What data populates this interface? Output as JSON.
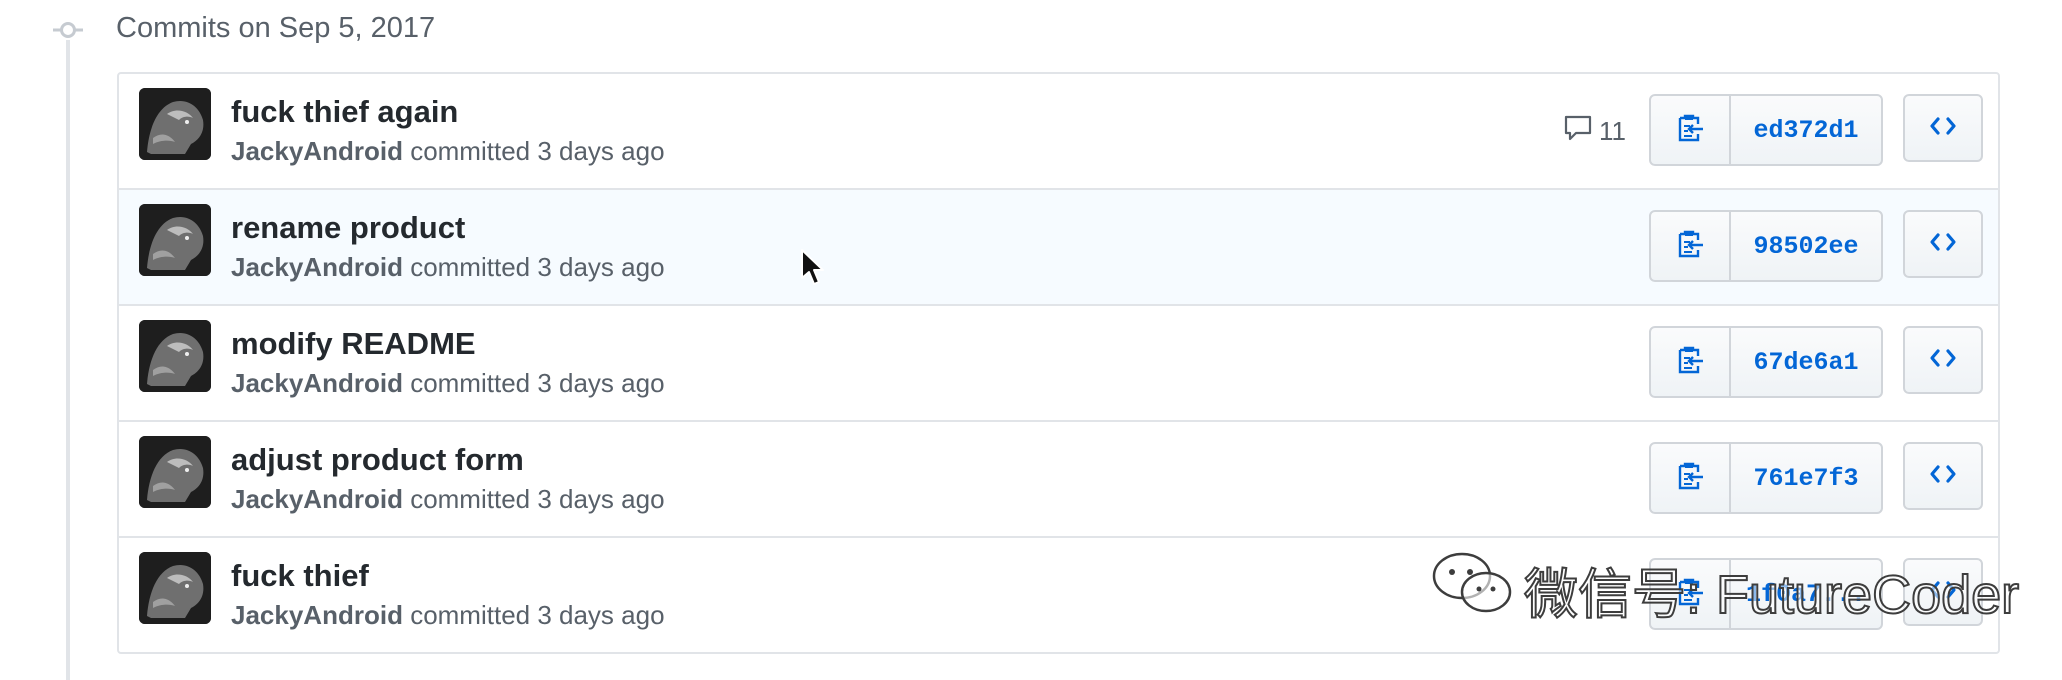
{
  "group": {
    "title": "Commits on Sep 5, 2017"
  },
  "commits": [
    {
      "message": "fuck thief again",
      "author": "JackyAndroid",
      "meta": "committed 3 days ago",
      "comments": "11",
      "sha": "ed372d1"
    },
    {
      "message": "rename product",
      "author": "JackyAndroid",
      "meta": "committed 3 days ago",
      "comments": "",
      "sha": "98502ee"
    },
    {
      "message": "modify README",
      "author": "JackyAndroid",
      "meta": "committed 3 days ago",
      "comments": "",
      "sha": "67de6a1"
    },
    {
      "message": "adjust product form",
      "author": "JackyAndroid",
      "meta": "committed 3 days ago",
      "comments": "",
      "sha": "761e7f3"
    },
    {
      "message": "fuck thief",
      "author": "JackyAndroid",
      "meta": "committed 3 days ago",
      "comments": "",
      "sha": "1f0a7..."
    }
  ],
  "watermark": {
    "text": "微信号: FutureCoder"
  },
  "colors": {
    "link": "#0366d6",
    "muted": "#586069",
    "border": "#e1e4e8",
    "hover_row": "#f6fbff"
  },
  "icons": {
    "timeline": "git-commit-icon",
    "comment": "comment-icon",
    "copy": "clippy-icon",
    "browse": "code-icon",
    "watermark": "wechat-icon"
  }
}
